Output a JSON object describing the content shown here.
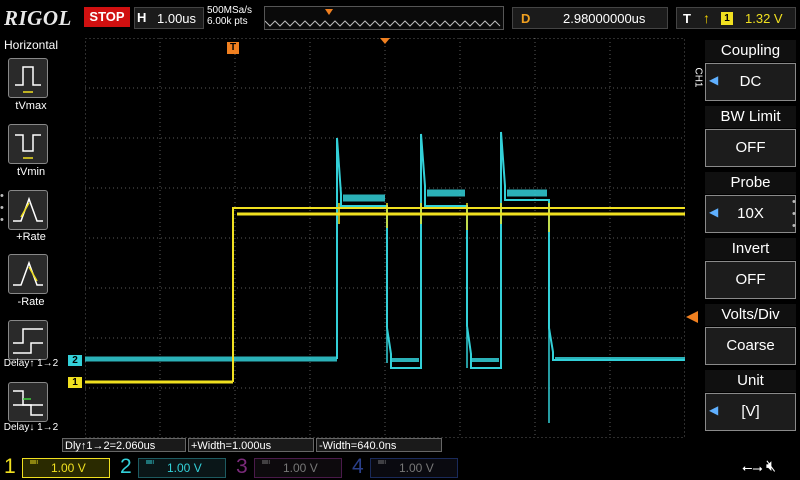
{
  "topbar": {
    "logo": "RIGOL",
    "run_state": "STOP",
    "horizontal_key": "H",
    "timebase": "1.00us",
    "sample_rate": "500MSa/s",
    "memory_depth": "6.00k pts",
    "delay_key": "D",
    "delay_value": "2.98000000us",
    "trigger_key": "T",
    "trigger_edge": "↑",
    "trigger_channel": "1",
    "trigger_level": "1.32 V"
  },
  "left_panel": {
    "title": "Horizontal",
    "items": [
      {
        "label": "tVmax"
      },
      {
        "label": "tVmin"
      },
      {
        "label": "+Rate"
      },
      {
        "label": "-Rate"
      },
      {
        "label": "Delay↑ 1→2"
      },
      {
        "label": "Delay↓ 1→2"
      }
    ]
  },
  "right_panel": {
    "channel_label": "CH1",
    "items": [
      {
        "title": "Coupling",
        "value": "DC"
      },
      {
        "title": "BW Limit",
        "value": "OFF"
      },
      {
        "title": "Probe",
        "value": "10X"
      },
      {
        "title": "Invert",
        "value": "OFF"
      },
      {
        "title": "Volts/Div",
        "value": "Coarse"
      },
      {
        "title": "Unit",
        "value": "[V]"
      }
    ]
  },
  "measurements": [
    {
      "text": "Dly↑1→2=2.060us"
    },
    {
      "text": "+Width=1.000us"
    },
    {
      "text": "-Width=640.0ns"
    }
  ],
  "markers": {
    "trigger_marker": "T",
    "ch1_marker": "1",
    "ch2_marker": "2"
  },
  "channels": [
    {
      "num": "1",
      "coupling": "≕",
      "vdiv": "1.00 V",
      "color": "#f0e020",
      "active": true
    },
    {
      "num": "2",
      "coupling": "≕",
      "vdiv": "1.00 V",
      "color": "#33d0d8",
      "active": false
    },
    {
      "num": "3",
      "coupling": "≕",
      "vdiv": "1.00 V",
      "color": "#c040c0",
      "active": false
    },
    {
      "num": "4",
      "coupling": "≕",
      "vdiv": "1.00 V",
      "color": "#3060e0",
      "active": false
    }
  ],
  "colors": {
    "ch1": "#f0e020",
    "ch2": "#33d0d8",
    "trigger_marker": "#f08020",
    "stop": "#d01010",
    "grid": "#5a5a5a"
  },
  "icons": [
    "usb-icon",
    "speaker-muted-icon"
  ]
}
